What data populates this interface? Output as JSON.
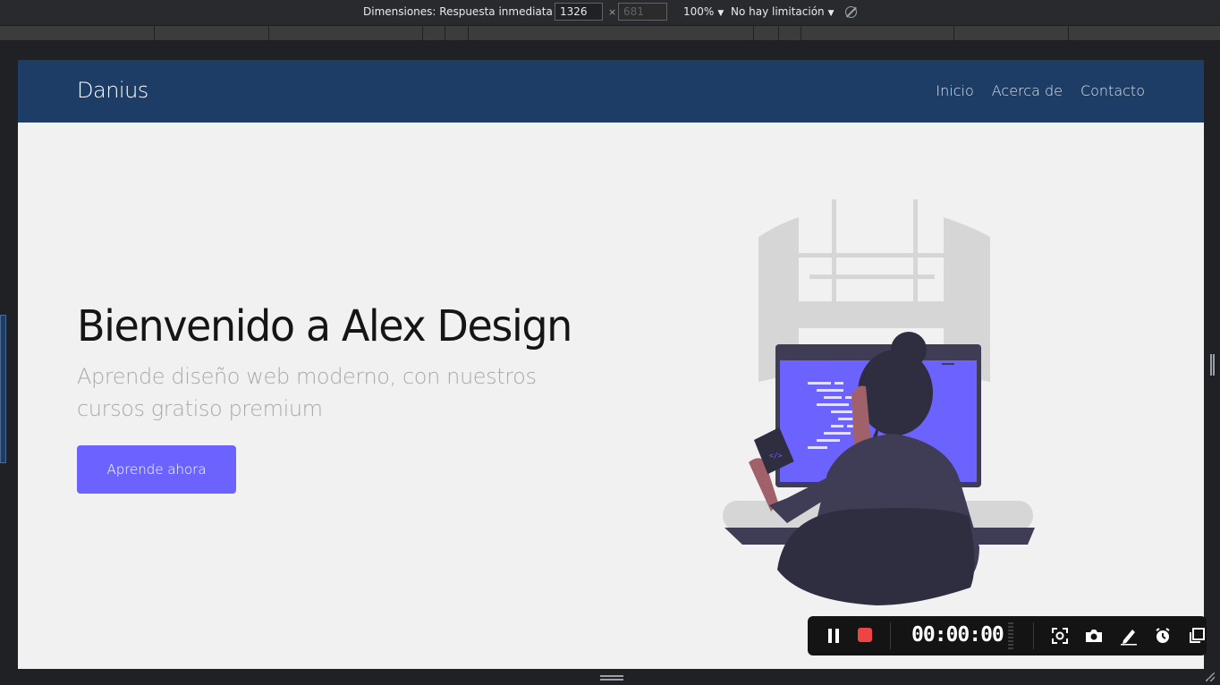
{
  "devtools": {
    "dimensions_label": "Dimensiones: Respuesta inmediata",
    "width_value": "1326",
    "height_value": "681",
    "dim_separator": "×",
    "zoom_label": "100%",
    "throttle_label": "No hay limitación",
    "dropdown_glyph": "▼"
  },
  "site": {
    "brand": "Danius",
    "nav": [
      "Inicio",
      "Acerca de",
      "Contacto"
    ],
    "hero": {
      "title": "Bienvenido a Alex Design",
      "subtitle": "Aprende diseño web moderno, con nuestros cursos gratiso premium",
      "cta_label": "Aprende ahora"
    },
    "colors": {
      "navbar": "#1d3d66",
      "accent": "#6c63ff",
      "page_background": "#f1f1f1"
    }
  },
  "recorder": {
    "timer": "00:00:00",
    "stop_color": "#ef4444",
    "icons": [
      "pause-icon",
      "stop-icon",
      "region-capture-icon",
      "camera-icon",
      "pen-icon",
      "timer-icon",
      "window-icon"
    ]
  }
}
